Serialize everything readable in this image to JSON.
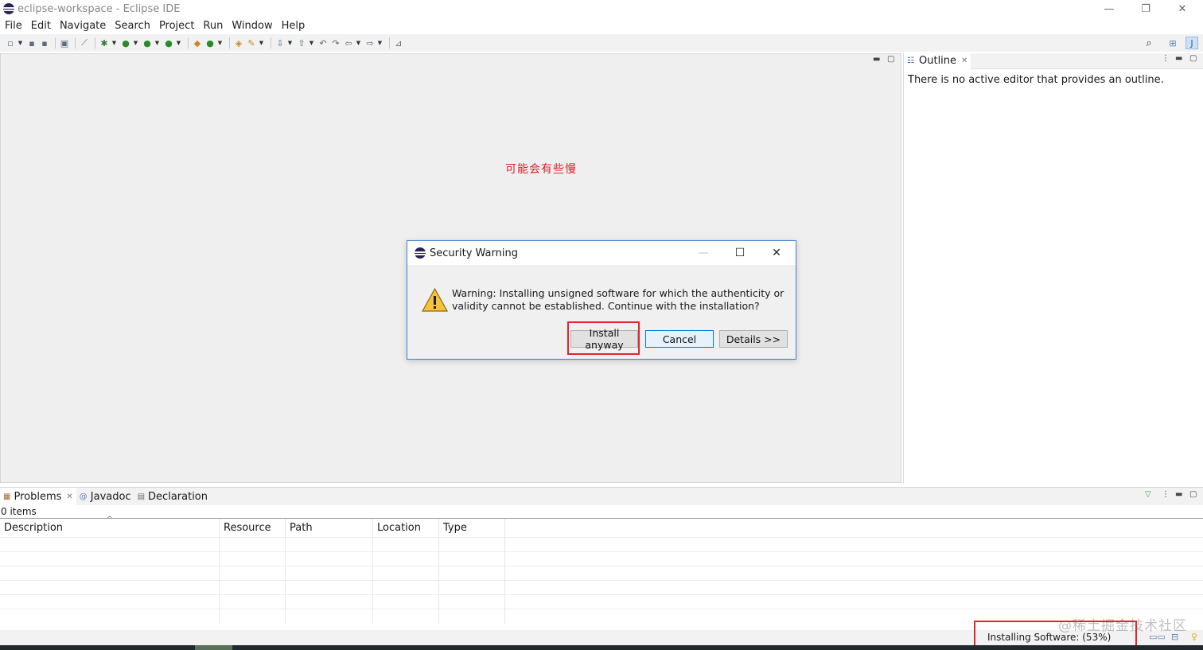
{
  "window": {
    "title": "eclipse-workspace - Eclipse IDE",
    "controls": {
      "minimize": "—",
      "restore": "❐",
      "close": "✕"
    }
  },
  "menu": [
    "File",
    "Edit",
    "Navigate",
    "Search",
    "Project",
    "Run",
    "Window",
    "Help"
  ],
  "annotation": {
    "note_cn": "可能会有些慢"
  },
  "outline": {
    "tab_label": "Outline",
    "message": "There is no active editor that provides an outline."
  },
  "bottom": {
    "tabs": [
      "Problems",
      "Javadoc",
      "Declaration"
    ],
    "items_count": "0 items",
    "columns": [
      "Description",
      "Resource",
      "Path",
      "Location",
      "Type"
    ]
  },
  "dialog": {
    "title": "Security Warning",
    "message": "Warning: Installing unsigned software for which the authenticity or validity cannot be established. Continue with the installation?",
    "buttons": {
      "install": "Install anyway",
      "cancel": "Cancel",
      "details": "Details >>"
    },
    "controls": {
      "minimize": "—",
      "maximize": "☐",
      "close": "✕"
    }
  },
  "status": {
    "progress_text": "Installing Software: (53%)",
    "progress_percent": 53
  },
  "watermark": "@稀土掘金技术社区",
  "icons": [
    "eclipse-icon",
    "search-icon",
    "perspective-icon",
    "warning-icon",
    "filter-icon",
    "view-menu-icon",
    "minimize-icon",
    "maximize-icon"
  ]
}
